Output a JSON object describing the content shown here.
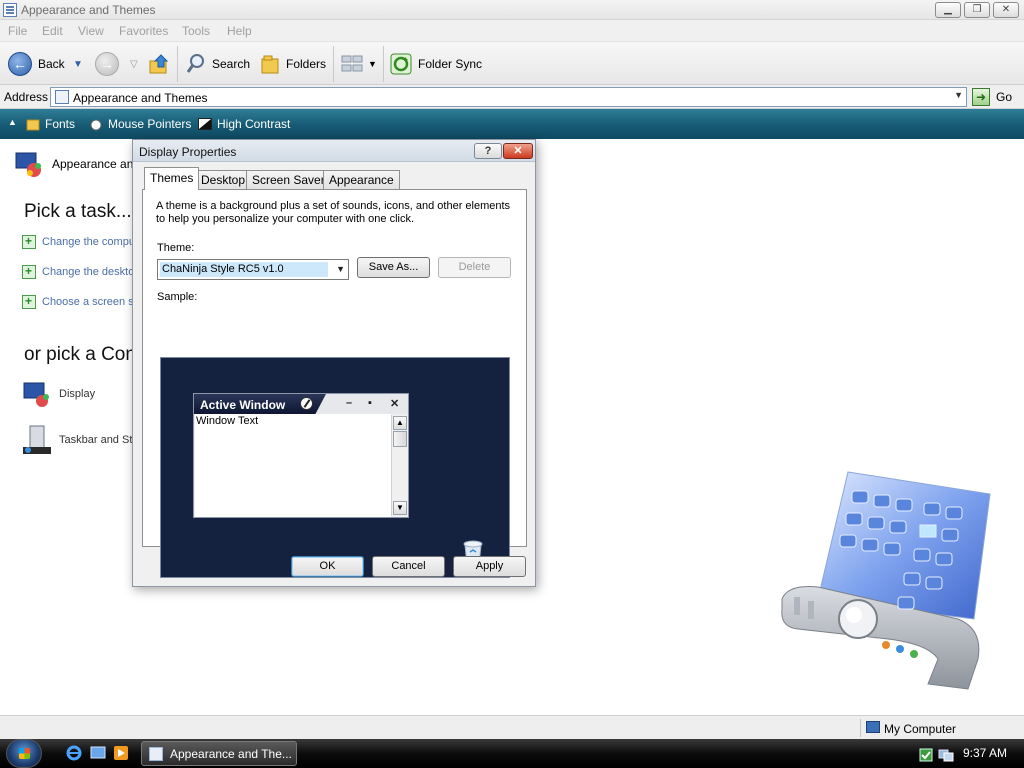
{
  "window": {
    "title": "Appearance and Themes",
    "menu": [
      "File",
      "Edit",
      "View",
      "Favorites",
      "Tools",
      "Help"
    ],
    "toolbar": {
      "back": "Back",
      "search": "Search",
      "folders": "Folders",
      "folder_sync": "Folder Sync"
    },
    "address": {
      "label": "Address",
      "value": "Appearance and Themes",
      "go": "Go"
    },
    "links": [
      "Fonts",
      "Mouse Pointers",
      "High Contrast"
    ]
  },
  "content": {
    "header_label": "Appearance and",
    "pick_task_heading": "Pick a task...",
    "tasks": [
      "Change the compu",
      "Change the deskto",
      "Choose a screen s"
    ],
    "pick_cp_heading": "or pick a Con",
    "control_panel_items": [
      "Display",
      "Taskbar and St"
    ]
  },
  "status": {
    "location": "My Computer"
  },
  "taskbar": {
    "button_label": "Appearance and The...",
    "clock": "9:37 AM"
  },
  "dialog": {
    "title": "Display Properties",
    "help_label": "?",
    "close_label": "✕",
    "tabs": [
      "Themes",
      "Desktop",
      "Screen Saver",
      "Appearance"
    ],
    "description_line1": "A theme is a background plus a set of sounds, icons, and other elements",
    "description_line2": "to help you personalize your computer with one click.",
    "theme_label": "Theme:",
    "theme_value": "ChaNinja Style RC5 v1.0",
    "save_as": "Save As...",
    "delete": "Delete",
    "sample_label": "Sample:",
    "sample_window_title": "Active Window",
    "sample_window_text": "Window Text",
    "ok": "OK",
    "cancel": "Cancel",
    "apply": "Apply"
  },
  "colors": {
    "links_bar": "#175a74",
    "sample_bg": "#142240",
    "close_button": "#cc3a1e"
  }
}
